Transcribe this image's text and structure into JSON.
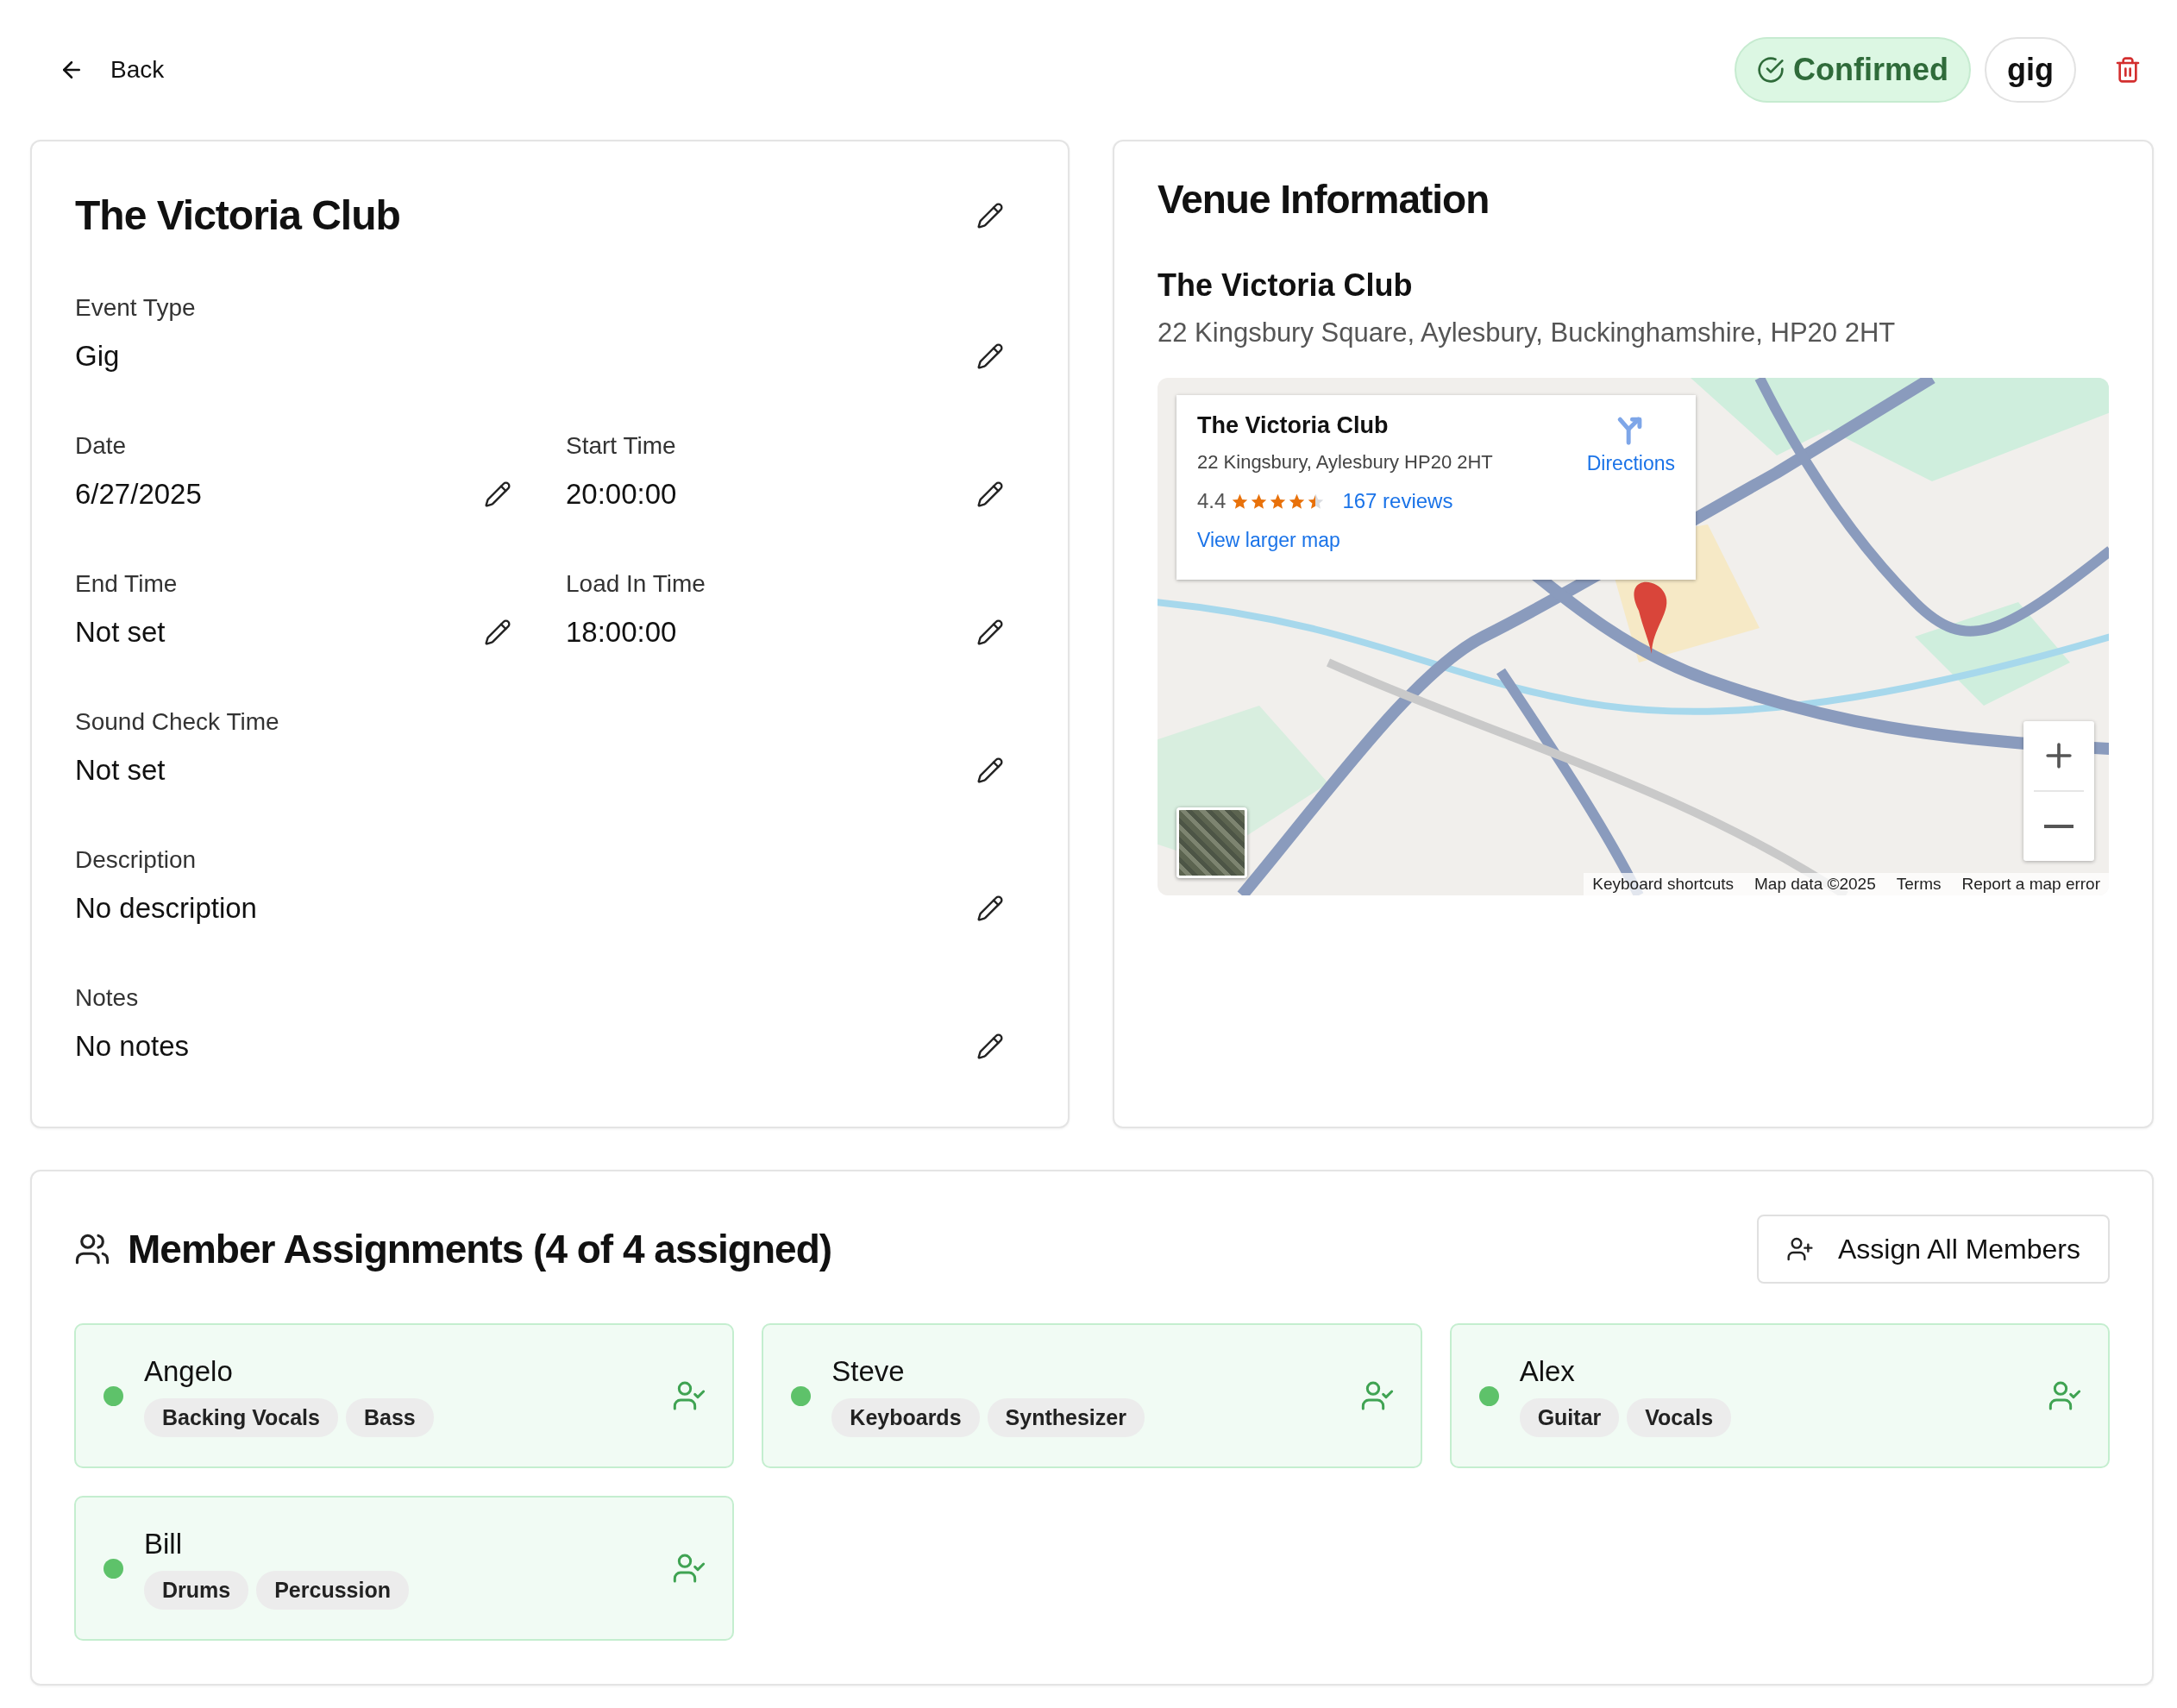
{
  "header": {
    "back": "Back",
    "status": "Confirmed",
    "type_tag": "gig"
  },
  "event": {
    "title": "The Victoria Club",
    "rows": [
      [
        {
          "label": "Event Type",
          "value": "Gig"
        }
      ],
      [
        {
          "label": "Date",
          "value": "6/27/2025"
        },
        {
          "label": "Start Time",
          "value": "20:00:00"
        }
      ],
      [
        {
          "label": "End Time",
          "value": "Not set"
        },
        {
          "label": "Load In Time",
          "value": "18:00:00"
        }
      ],
      [
        {
          "label": "Sound Check Time",
          "value": "Not set"
        }
      ],
      [
        {
          "label": "Description",
          "value": "No description"
        }
      ],
      [
        {
          "label": "Notes",
          "value": "No notes"
        }
      ]
    ]
  },
  "venue": {
    "heading": "Venue Information",
    "name": "The Victoria Club",
    "address": "22 Kingsbury Square, Aylesbury, Buckinghamshire, HP20 2HT",
    "map": {
      "kind": "picture",
      "place_card": {
        "name": "The Victoria Club",
        "address": "22 Kingsbury, Aylesbury HP20 2HT",
        "rating": "4.4",
        "stars": 4.5,
        "reviews": "167 reviews",
        "larger_map": "View larger map",
        "directions": "Directions"
      },
      "footer": [
        "Keyboard shortcuts",
        "Map data ©2025",
        "Terms",
        "Report a map error"
      ]
    }
  },
  "members": {
    "title": "Member Assignments (4 of 4 assigned)",
    "assign_button": "Assign All Members",
    "items": [
      {
        "name": "Angelo",
        "color": "#5ec26a",
        "roles": [
          "Backing Vocals",
          "Bass"
        ]
      },
      {
        "name": "Steve",
        "color": "#5ec26a",
        "roles": [
          "Keyboards",
          "Synthesizer"
        ]
      },
      {
        "name": "Alex",
        "color": "#5ec26a",
        "roles": [
          "Guitar",
          "Vocals"
        ]
      },
      {
        "name": "Bill",
        "color": "#5ec26a",
        "roles": [
          "Drums",
          "Percussion"
        ]
      }
    ]
  }
}
